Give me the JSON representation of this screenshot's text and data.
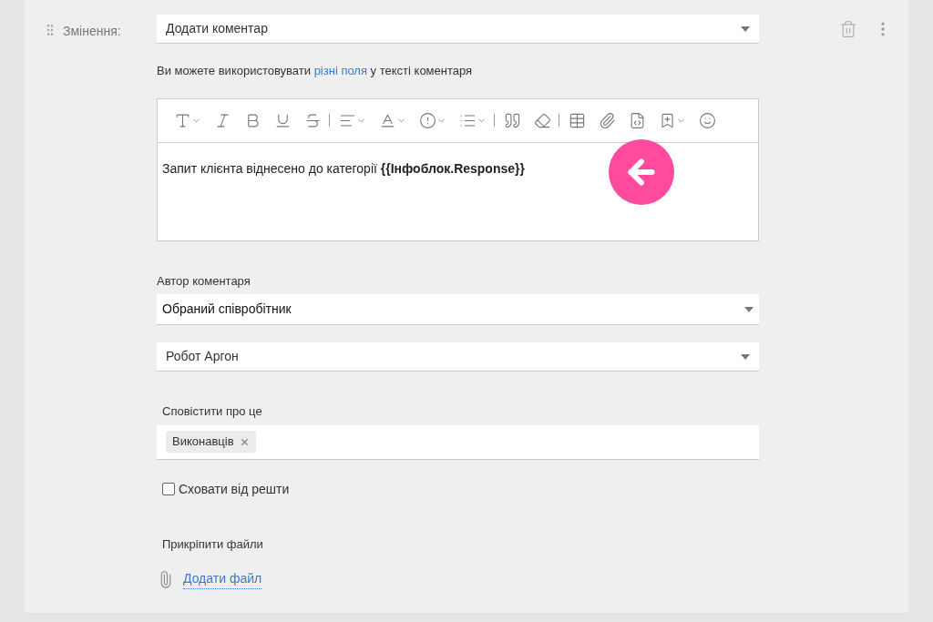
{
  "action": {
    "label": "Змінення:",
    "value": "Додати коментар"
  },
  "hint": {
    "before": "Ви можете використовувати ",
    "link": "різні поля",
    "after": " у тексті коментаря"
  },
  "editor": {
    "text": "Запит клієнта віднесено до категорії **{{Інфоблок.Response}}**"
  },
  "author": {
    "label": "Автор коментаря",
    "value": "Обраний співробітник",
    "user": "Робот Аргон"
  },
  "notify": {
    "label": "Сповістити про це",
    "tags": [
      "Виконавців"
    ]
  },
  "hide": {
    "label": "Сховати від решти",
    "checked": false
  },
  "attach": {
    "label": "Прикріпити файли",
    "link": "Додати файл"
  }
}
